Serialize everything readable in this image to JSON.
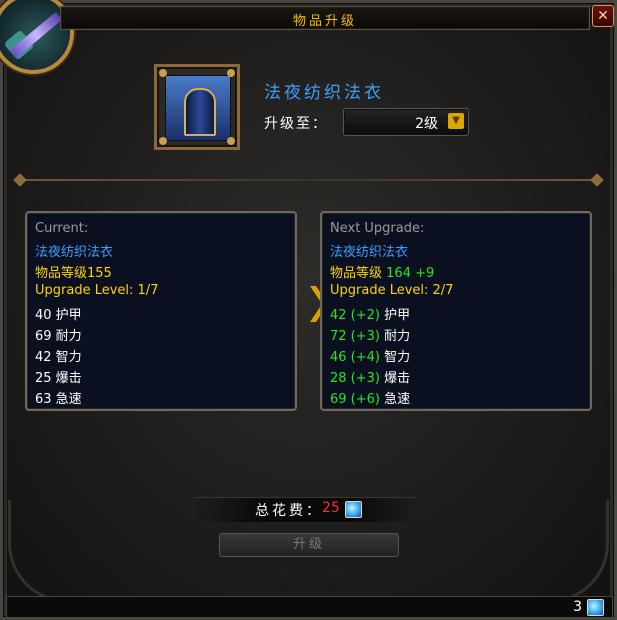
{
  "window": {
    "title": "物品升级"
  },
  "item": {
    "name": "法夜纺织法衣",
    "icon": "robe-icon"
  },
  "selector": {
    "label": "升级至：",
    "value": "2级"
  },
  "current": {
    "header": "Current:",
    "name": "法夜纺织法衣",
    "item_level": "物品等级155",
    "upgrade_level": "Upgrade Level: 1/7",
    "stats": [
      "40 护甲",
      "69 耐力",
      "42 智力",
      "25 爆击",
      "63 急速"
    ]
  },
  "next": {
    "header": "Next Upgrade:",
    "name": "法夜纺织法衣",
    "item_level_label": "物品等级",
    "item_level_value": "164 +9",
    "upgrade_level": "Upgrade Level: 2/7",
    "stats": [
      {
        "value": "42 (+2)",
        "label": "护甲"
      },
      {
        "value": "72 (+3)",
        "label": "耐力"
      },
      {
        "value": "46 (+4)",
        "label": "智力"
      },
      {
        "value": "28 (+3)",
        "label": "爆击"
      },
      {
        "value": "69 (+6)",
        "label": "急速"
      }
    ]
  },
  "cost": {
    "label": "总花费：",
    "amount": "25",
    "icon": "valor-gem-icon"
  },
  "upgrade_button": {
    "label": "升级"
  },
  "currency": {
    "amount": "3",
    "icon": "valor-gem-icon"
  },
  "colors": {
    "title": "#f2c200",
    "item_name": "#3aa0ff",
    "gain": "#22e822",
    "cost": "#ff2a2a",
    "upgrade_level": "#ffd200"
  }
}
